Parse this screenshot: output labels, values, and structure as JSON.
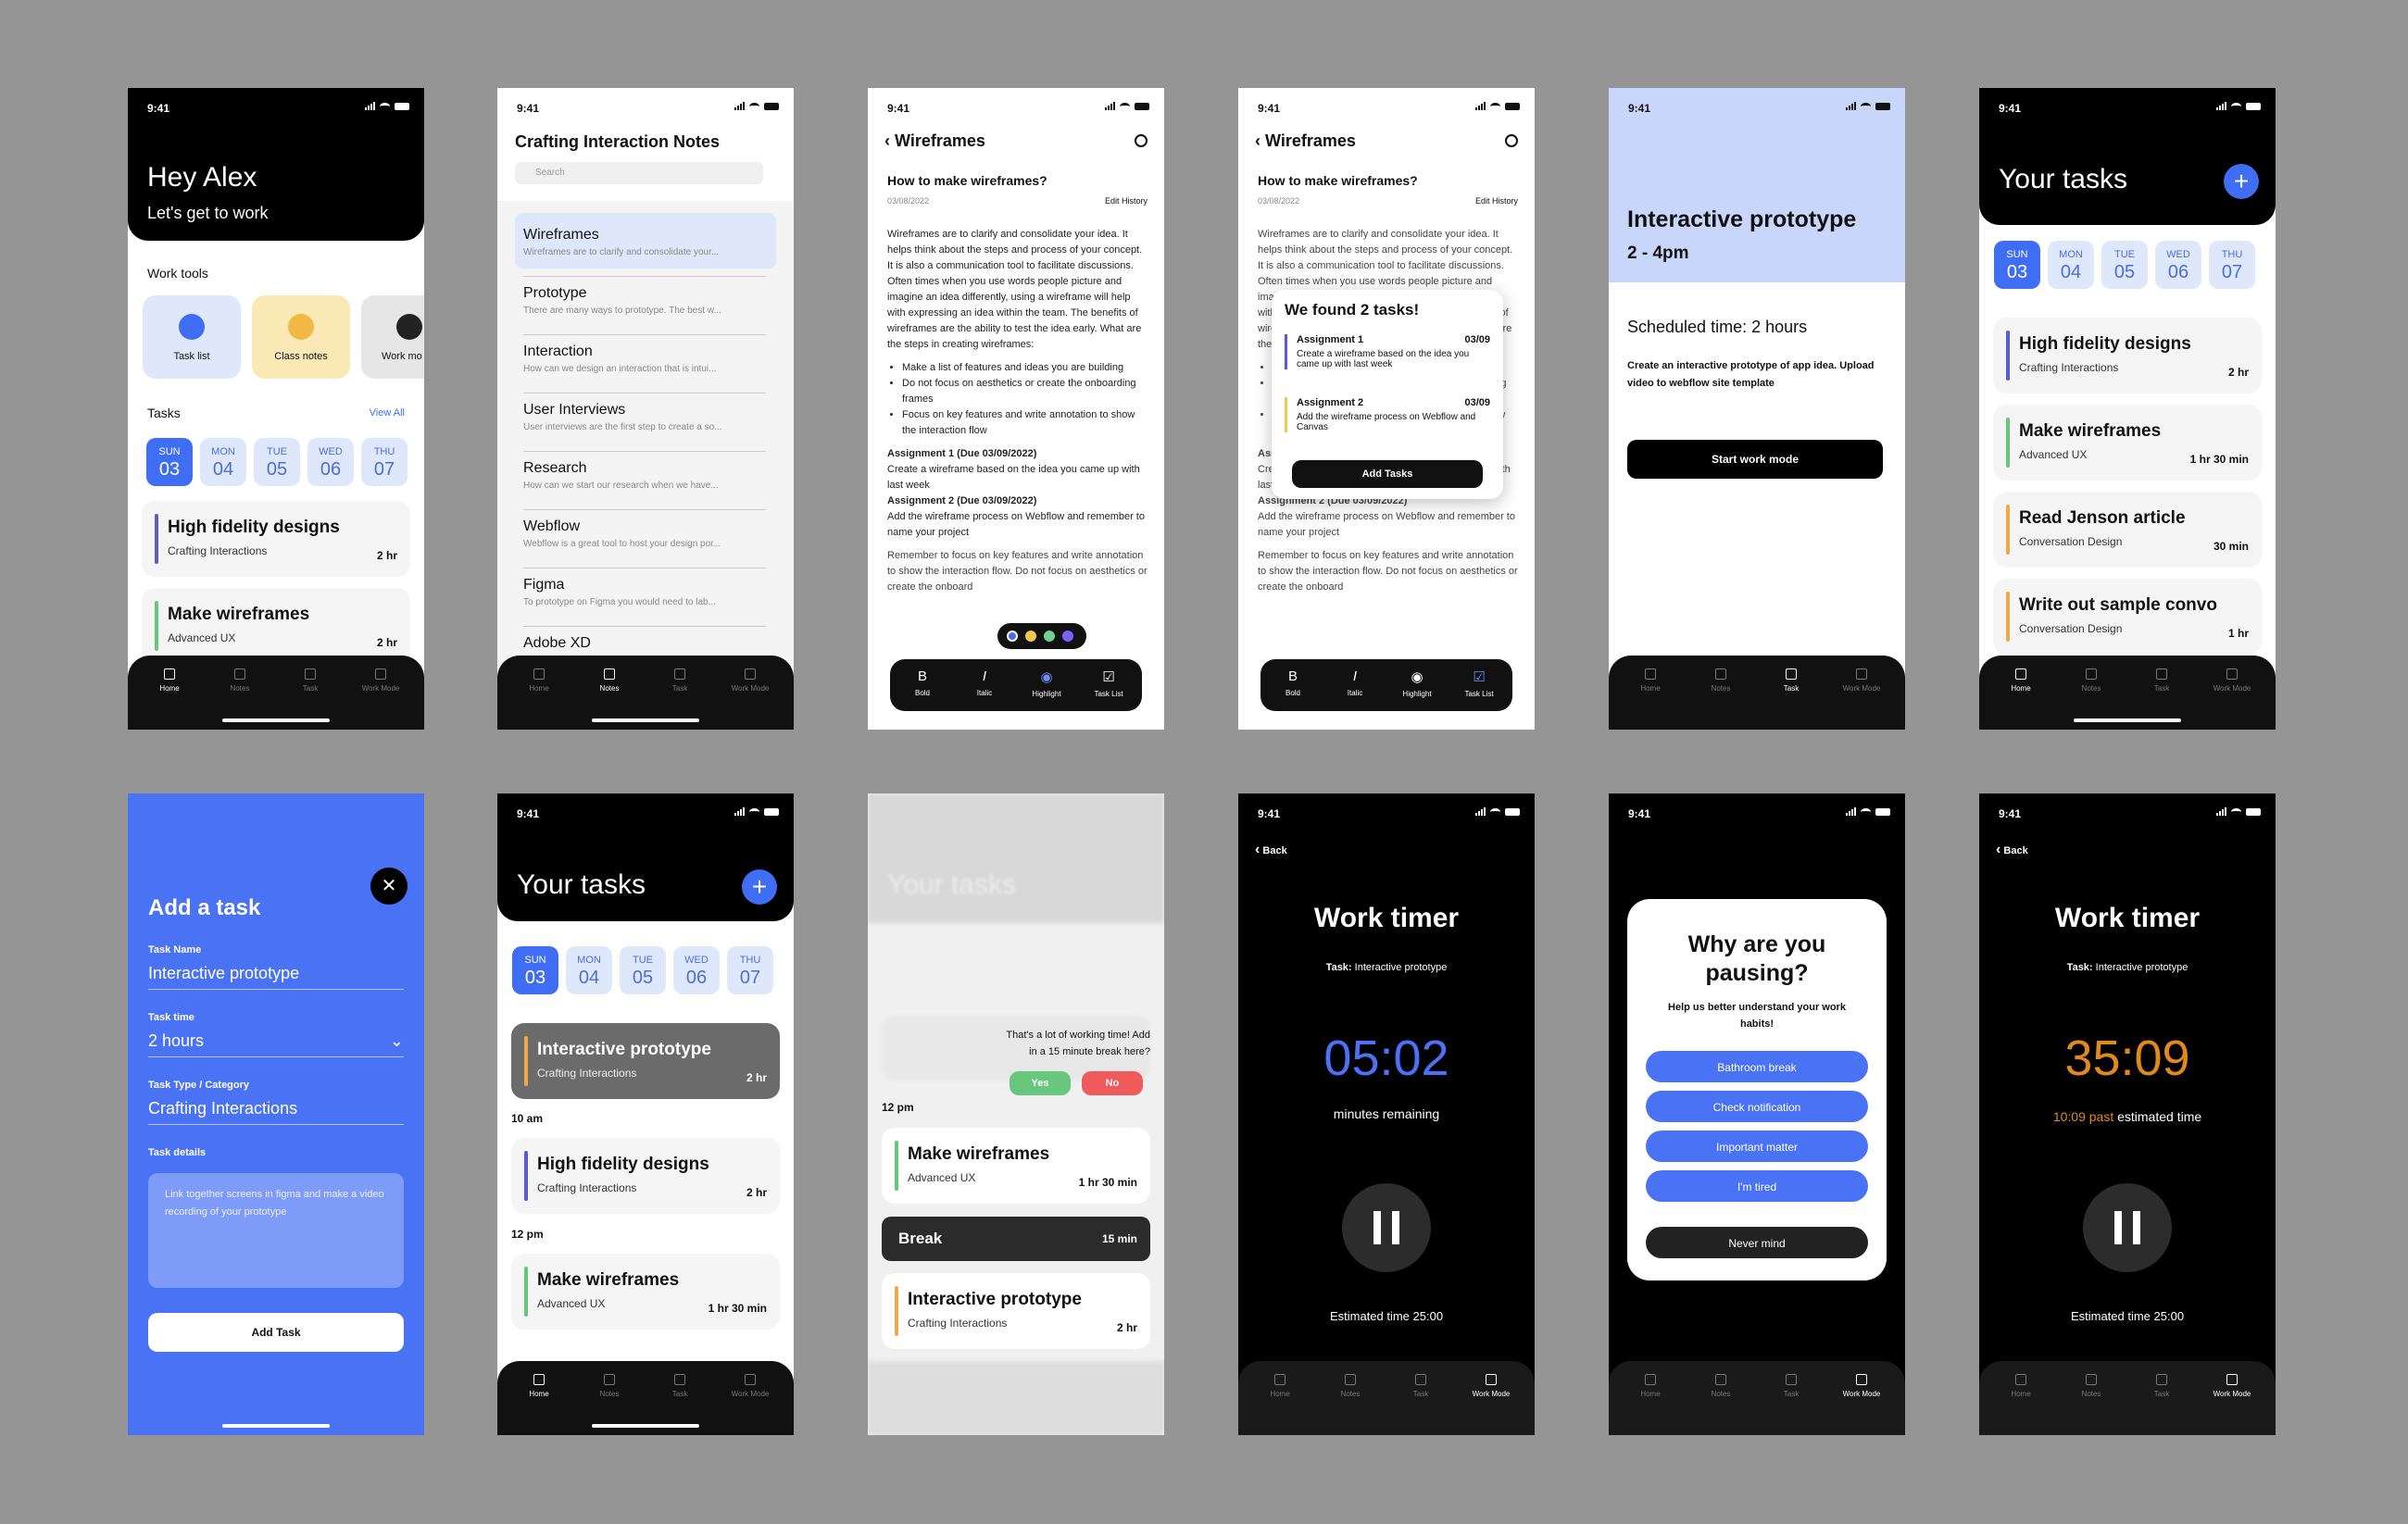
{
  "status_time": "9:41",
  "tabs": [
    "Home",
    "Notes",
    "Task",
    "Work Mode"
  ],
  "tabs_tasklist": [
    "Home",
    "Notes",
    "Task",
    "Work Mode"
  ],
  "days": [
    {
      "n": "SUN",
      "d": "03"
    },
    {
      "n": "MON",
      "d": "04"
    },
    {
      "n": "TUE",
      "d": "05"
    },
    {
      "n": "WED",
      "d": "06"
    },
    {
      "n": "THU",
      "d": "07"
    }
  ],
  "home": {
    "greeting": "Hey Alex",
    "subtitle": "Let's get to work",
    "work_tools": "Work tools",
    "tools": [
      "Task list",
      "Class notes",
      "Work mo"
    ],
    "tasks": "Tasks",
    "view_all": "View All"
  },
  "notes": {
    "title": "Crafting Interaction Notes",
    "search": "Search",
    "items": [
      {
        "t": "Wireframes",
        "s": "Wireframes are to clarify and consolidate your..."
      },
      {
        "t": "Prototype",
        "s": "There are many ways to prototype. The best w..."
      },
      {
        "t": "Interaction",
        "s": "How can we design an interaction that is intui..."
      },
      {
        "t": "User Interviews",
        "s": "User interviews are the first step to create a so..."
      },
      {
        "t": "Research",
        "s": "How can we start our research when we have..."
      },
      {
        "t": "Webflow",
        "s": "Webflow is a great tool to host your design por..."
      },
      {
        "t": "Figma",
        "s": "To prototype on Figma you would need to lab..."
      },
      {
        "t": "Adobe XD",
        "s": ""
      }
    ]
  },
  "doc": {
    "title": "Wireframes",
    "heading": "How to make wireframes?",
    "date": "03/08/2022",
    "edit": "Edit History",
    "p1": "Wireframes are to clarify and consolidate your idea. It helps think about the steps and process of your concept. It is also a communication tool to facilitate discussions. Often times when you use words people picture and imagine an idea differently, using a wireframe will help with expressing an idea within the team. The benefits of wireframes are the ability to test the idea early. What are the steps in creating wireframes:",
    "bullets": [
      "Make a list of features and ideas you are building",
      "Do not focus on aesthetics or create the onboarding frames",
      "Focus on key features and write annotation to show the interaction flow"
    ],
    "a1h": "Assignment 1 (Due 03/09/2022)",
    "a1": "Create a wireframe based on the idea you came up with last week",
    "a2h": "Assignment 2 (Due 03/09/2022)",
    "a2": "Add the wireframe process on Webflow and remember to name your project",
    "rem": "Remember to focus on key features and write annotation to show the interaction flow. Do not focus on aesthetics or create the onboard",
    "fmt": [
      "Bold",
      "Italic",
      "Highlight",
      "Task List"
    ]
  },
  "found": {
    "title": "We found 2 tasks!",
    "a1": "Assignment 1",
    "a1d": "03/09",
    "a1t": "Create a wireframe based on the idea you came up with last week",
    "a2": "Assignment 2",
    "a2d": "03/09",
    "a2t": "Add the wireframe process on Webflow and Canvas",
    "btn": "Add Tasks"
  },
  "detail": {
    "title": "Interactive prototype",
    "time": "2 - 4pm",
    "sched": "Scheduled time: 2 hours",
    "desc": "Create an interactive prototype of app idea. Upload video to webflow site template",
    "btn": "Start work mode"
  },
  "tasks": {
    "title": "Your tasks",
    "list": [
      {
        "t": "High fidelity designs",
        "s": "Crafting Interactions",
        "d": "2 hr",
        "c": "#5b5bd6"
      },
      {
        "t": "Make wireframes",
        "s": "Advanced UX",
        "d": "1 hr 30 min",
        "c": "#67c77d"
      },
      {
        "t": "Read Jenson article",
        "s": "Conversation Design",
        "d": "30 min",
        "c": "#f0a84a"
      },
      {
        "t": "Write out sample convo",
        "s": "Conversation Design",
        "d": "1 hr",
        "c": "#f0a84a"
      }
    ]
  },
  "add": {
    "title": "Add a task",
    "name_l": "Task Name",
    "name_v": "Interactive prototype",
    "time_l": "Task time",
    "time_v": "2 hours",
    "type_l": "Task Type / Category",
    "type_v": "Crafting Interactions",
    "det_l": "Task details",
    "det_v": "Link together screens in figma and make a video recording of your prototype",
    "btn": "Add Task"
  },
  "sched": {
    "times": [
      "10 am",
      "12 pm"
    ],
    "break": "Break",
    "break_d": "15 min"
  },
  "blur": {
    "msg": "That's a lot of working time! Add in a 15 minute break here?",
    "yes": "Yes",
    "no": "No",
    "time": "12 pm",
    "break": "Break",
    "break_d": "15 min"
  },
  "timer": {
    "back": "Back",
    "title": "Work timer",
    "task_l": "Task:",
    "task_v": "Interactive prototype",
    "t1": "05:02",
    "r1": "minutes remaining",
    "est": "Estimated time 25:00",
    "t2": "35:09",
    "past": "10:09 past",
    "estimated": "estimated time"
  },
  "pause": {
    "title": "Why are you pausing?",
    "sub": "Help us better understand your work habits!",
    "opts": [
      "Bathroom break",
      "Check notification",
      "Important matter",
      "I'm tired"
    ],
    "never": "Never mind"
  },
  "colors": {
    "blue": "#3f6ef4",
    "orange": "#e08a1e",
    "black": "#000000"
  }
}
